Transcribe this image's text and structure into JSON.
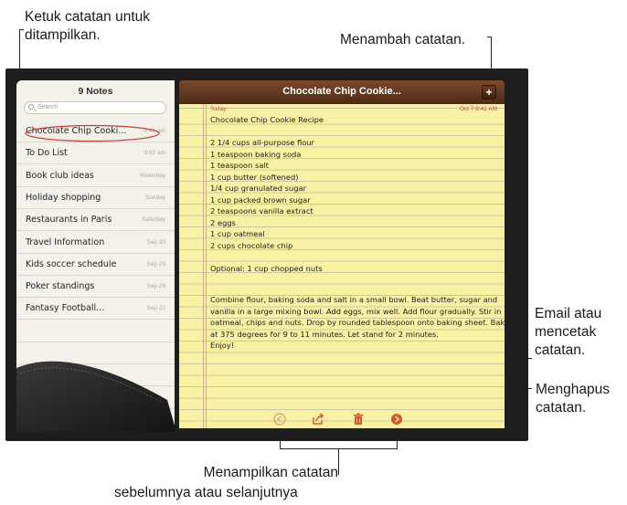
{
  "callouts": {
    "tap_note": [
      "Ketuk catatan untuk",
      "ditampilkan."
    ],
    "add_note": "Menambah catatan.",
    "email_print": [
      "Email atau",
      "mencetak",
      "catatan."
    ],
    "delete_note": [
      "Menghapus",
      "catatan."
    ],
    "prev_next": [
      "Menampilkan catatan",
      "sebelumnya atau selanjutnya"
    ]
  },
  "list": {
    "title": "9 Notes",
    "search_placeholder": "Search",
    "notes": [
      {
        "title": "Chocolate Chip Cooki...",
        "date": "9:41 am",
        "selected": true
      },
      {
        "title": "To Do List",
        "date": "9:02 am"
      },
      {
        "title": "Book club ideas",
        "date": "Yesterday"
      },
      {
        "title": "Holiday shopping",
        "date": "Sunday"
      },
      {
        "title": "Restaurants in Paris",
        "date": "Saturday"
      },
      {
        "title": "Travel Information",
        "date": "Sep 30"
      },
      {
        "title": "Kids soccer schedule",
        "date": "Sep 29"
      },
      {
        "title": "Poker standings",
        "date": "Sep 29"
      },
      {
        "title": "Fantasy Football...",
        "date": "Sep 22"
      }
    ]
  },
  "note": {
    "header_title": "Chocolate Chip Cookie...",
    "add_label": "+",
    "date_label": "Today",
    "date": "Oct 7  9:41 AM",
    "lines": [
      "Chocolate Chip Cookie Recipe",
      "",
      "2 1/4 cups all-purpose flour",
      "1 teaspoon baking soda",
      "1 teaspoon salt",
      "1 cup butter (softened)",
      "1/4 cup granulated sugar",
      "1 cup packed brown sugar",
      "2 teaspoons vanilla extract",
      "2 eggs",
      "1 cup oatmeal",
      "2 cups chocolate chip",
      "",
      "Optional: 1 cup chopped nuts",
      "",
      "",
      "Combine flour, baking soda and salt in a small bowl. Beat butter, sugar and",
      "vanilla in a large mixing bowl. Add eggs, mix well. Add flour gradually. Stir in",
      "oatmeal, chips and nuts. Drop by rounded tablespoon onto baking sheet. Bake",
      "at 375 degrees for 9 to 11 minutes. Let stand for 2 minutes.",
      "Enjoy!"
    ]
  },
  "icons": {
    "previous": "previous-arrow-icon",
    "share": "share-icon",
    "trash": "trash-icon",
    "next": "next-arrow-icon"
  },
  "colors": {
    "paper": "#f8f1a3",
    "header": "#5e3520",
    "accent_red": "#c0533a",
    "tool_icon": "#d05a2a"
  }
}
